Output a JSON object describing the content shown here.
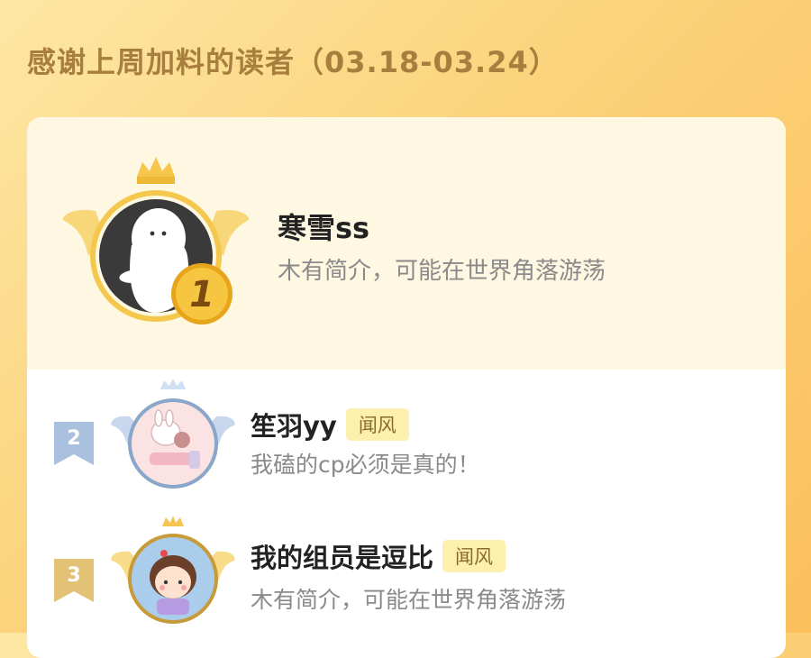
{
  "header": {
    "title": "感谢上周加料的读者（03.18-03.24）"
  },
  "colors": {
    "accent": "#a87e3e",
    "card_top_bg": "#fef7e1",
    "gold": "#f6c54a",
    "silver_blue": "#9fb9d9",
    "tag_bg": "#fdefae"
  },
  "leaderboard": {
    "first": {
      "rank": "1",
      "name": "寒雪ss",
      "bio": "木有简介，可能在世界角落游荡",
      "icons": [
        "crown-icon",
        "wings-icon",
        "ghost-avatar"
      ]
    },
    "others": [
      {
        "rank": "2",
        "name": "笙羽yy",
        "tag": "闻风",
        "bio": "我磕的cp必须是真的！"
      },
      {
        "rank": "3",
        "name": "我的组员是逗比",
        "tag": "闻风",
        "bio": "木有简介，可能在世界角落游荡"
      }
    ]
  }
}
